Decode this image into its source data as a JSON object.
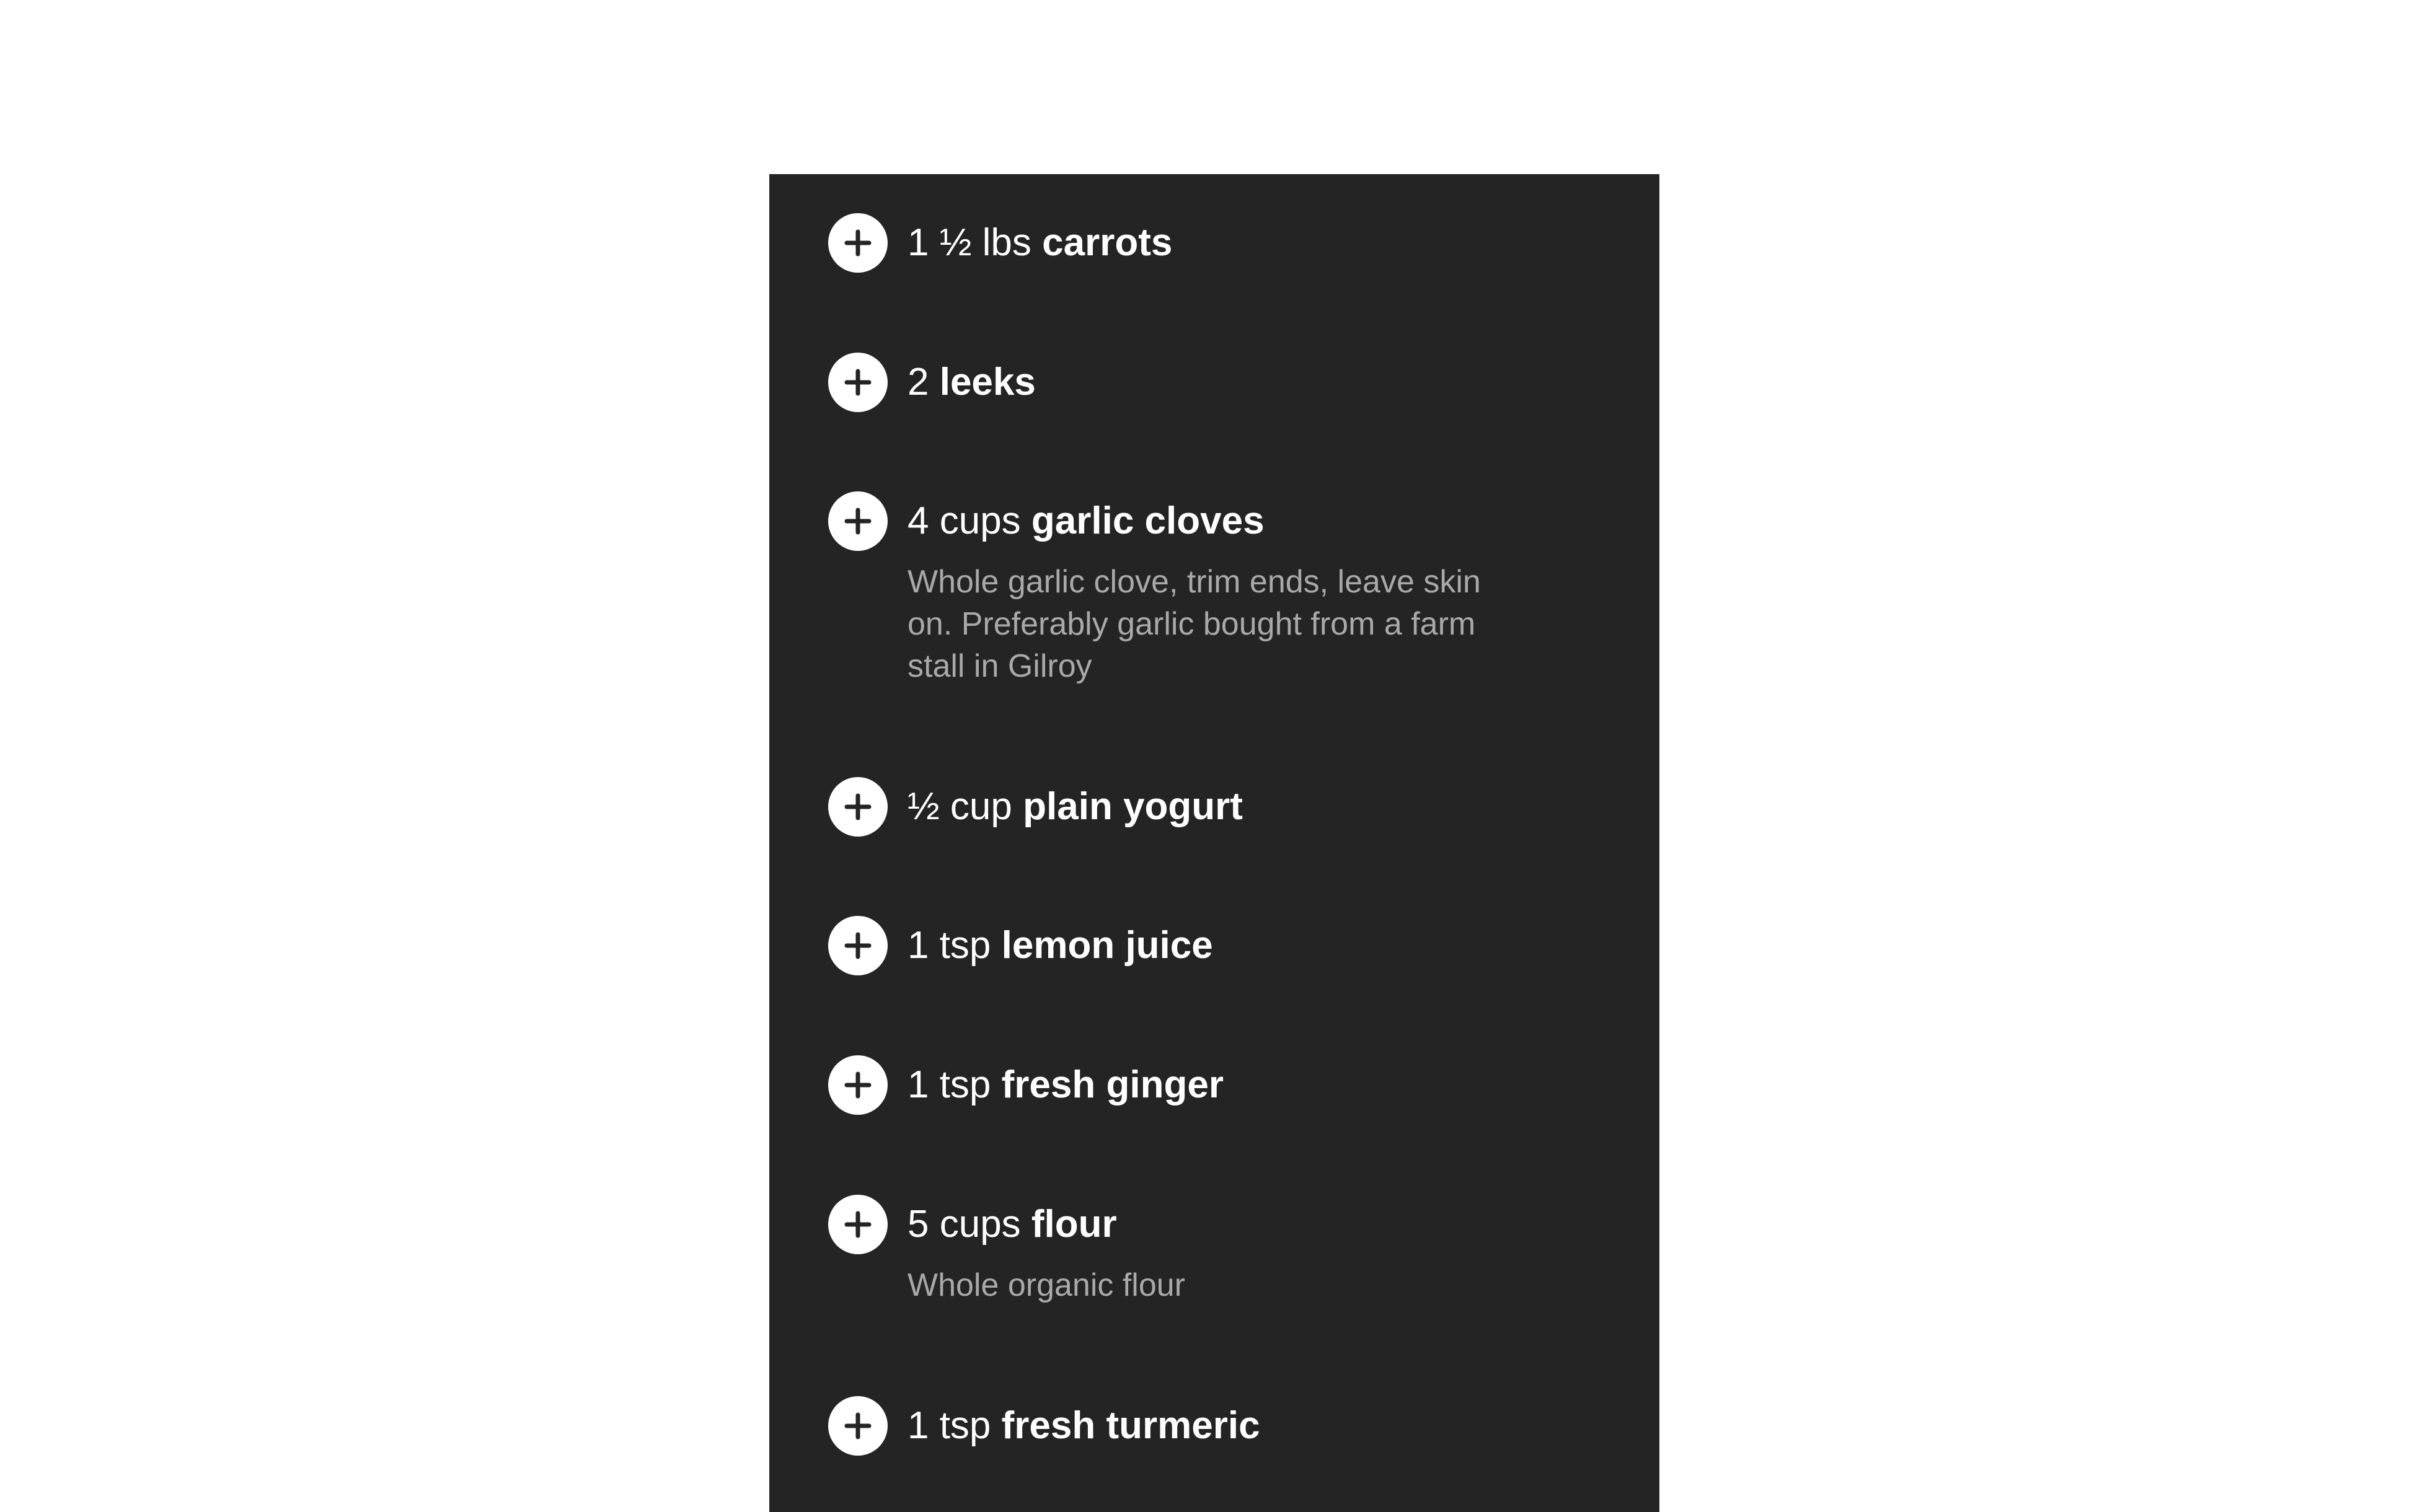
{
  "ingredients": [
    {
      "qty": "1 ½ lbs",
      "name": "carrots",
      "note": ""
    },
    {
      "qty": "2",
      "name": "leeks",
      "note": ""
    },
    {
      "qty": "4 cups",
      "name": "garlic cloves",
      "note": "Whole garlic clove, trim ends, leave skin on. Preferably garlic bought from a farm stall in Gilroy"
    },
    {
      "qty": "½ cup",
      "name": "plain yogurt",
      "note": ""
    },
    {
      "qty": "1 tsp",
      "name": "lemon juice",
      "note": ""
    },
    {
      "qty": "1 tsp",
      "name": "fresh ginger",
      "note": ""
    },
    {
      "qty": "5 cups",
      "name": "flour",
      "note": "Whole organic flour"
    },
    {
      "qty": "1 tsp",
      "name": "fresh turmeric",
      "note": ""
    }
  ],
  "icons": {
    "add": "plus-circle-icon"
  },
  "colors": {
    "panel": "#242424",
    "text": "#ffffff",
    "note": "#a9a9a9",
    "button": "#ffffff",
    "button_icon": "#242424"
  }
}
